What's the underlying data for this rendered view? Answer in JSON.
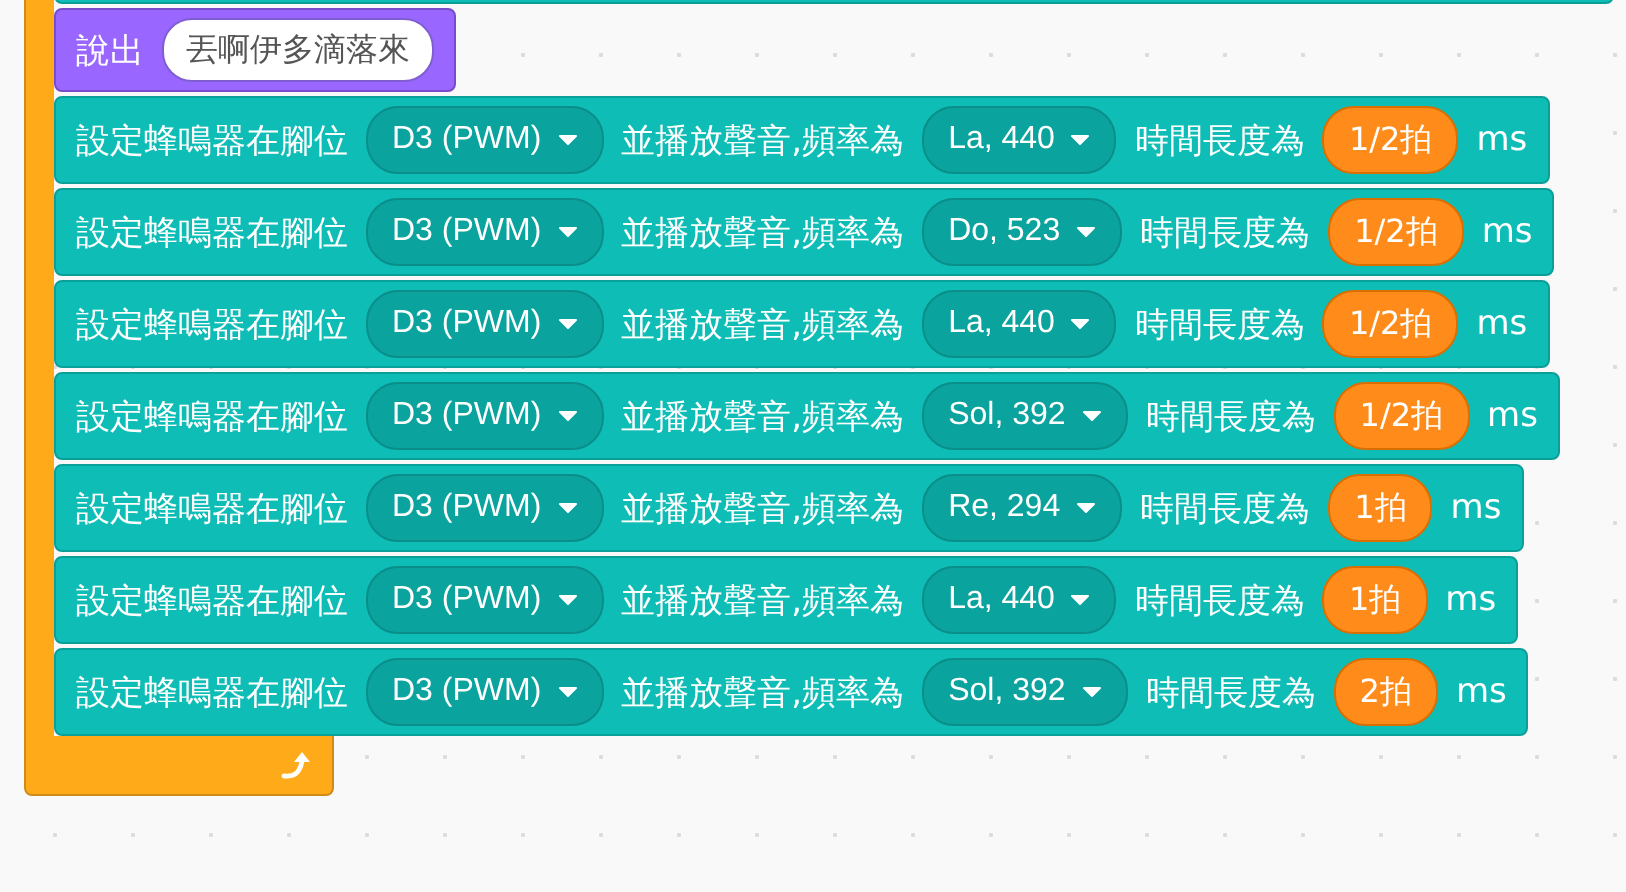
{
  "say_block": {
    "label": "說出",
    "value": "丟啊伊多滴落來"
  },
  "buzzer_blocks": [
    {
      "pin_label": "設定蜂鳴器在腳位",
      "pin": "D3 (PWM)",
      "tone_label": "並播放聲音,頻率為",
      "note": "La, 440",
      "duration_label": "時間長度為",
      "beats": "1/2拍",
      "unit": "ms"
    },
    {
      "pin_label": "設定蜂鳴器在腳位",
      "pin": "D3 (PWM)",
      "tone_label": "並播放聲音,頻率為",
      "note": "Do, 523",
      "duration_label": "時間長度為",
      "beats": "1/2拍",
      "unit": "ms"
    },
    {
      "pin_label": "設定蜂鳴器在腳位",
      "pin": "D3 (PWM)",
      "tone_label": "並播放聲音,頻率為",
      "note": "La, 440",
      "duration_label": "時間長度為",
      "beats": "1/2拍",
      "unit": "ms"
    },
    {
      "pin_label": "設定蜂鳴器在腳位",
      "pin": "D3 (PWM)",
      "tone_label": "並播放聲音,頻率為",
      "note": "Sol, 392",
      "duration_label": "時間長度為",
      "beats": "1/2拍",
      "unit": "ms"
    },
    {
      "pin_label": "設定蜂鳴器在腳位",
      "pin": "D3 (PWM)",
      "tone_label": "並播放聲音,頻率為",
      "note": "Re, 294",
      "duration_label": "時間長度為",
      "beats": "1拍",
      "unit": "ms"
    },
    {
      "pin_label": "設定蜂鳴器在腳位",
      "pin": "D3 (PWM)",
      "tone_label": "並播放聲音,頻率為",
      "note": "La, 440",
      "duration_label": "時間長度為",
      "beats": "1拍",
      "unit": "ms"
    },
    {
      "pin_label": "設定蜂鳴器在腳位",
      "pin": "D3 (PWM)",
      "tone_label": "並播放聲音,頻率為",
      "note": "Sol, 392",
      "duration_label": "時間長度為",
      "beats": "2拍",
      "unit": "ms"
    }
  ]
}
